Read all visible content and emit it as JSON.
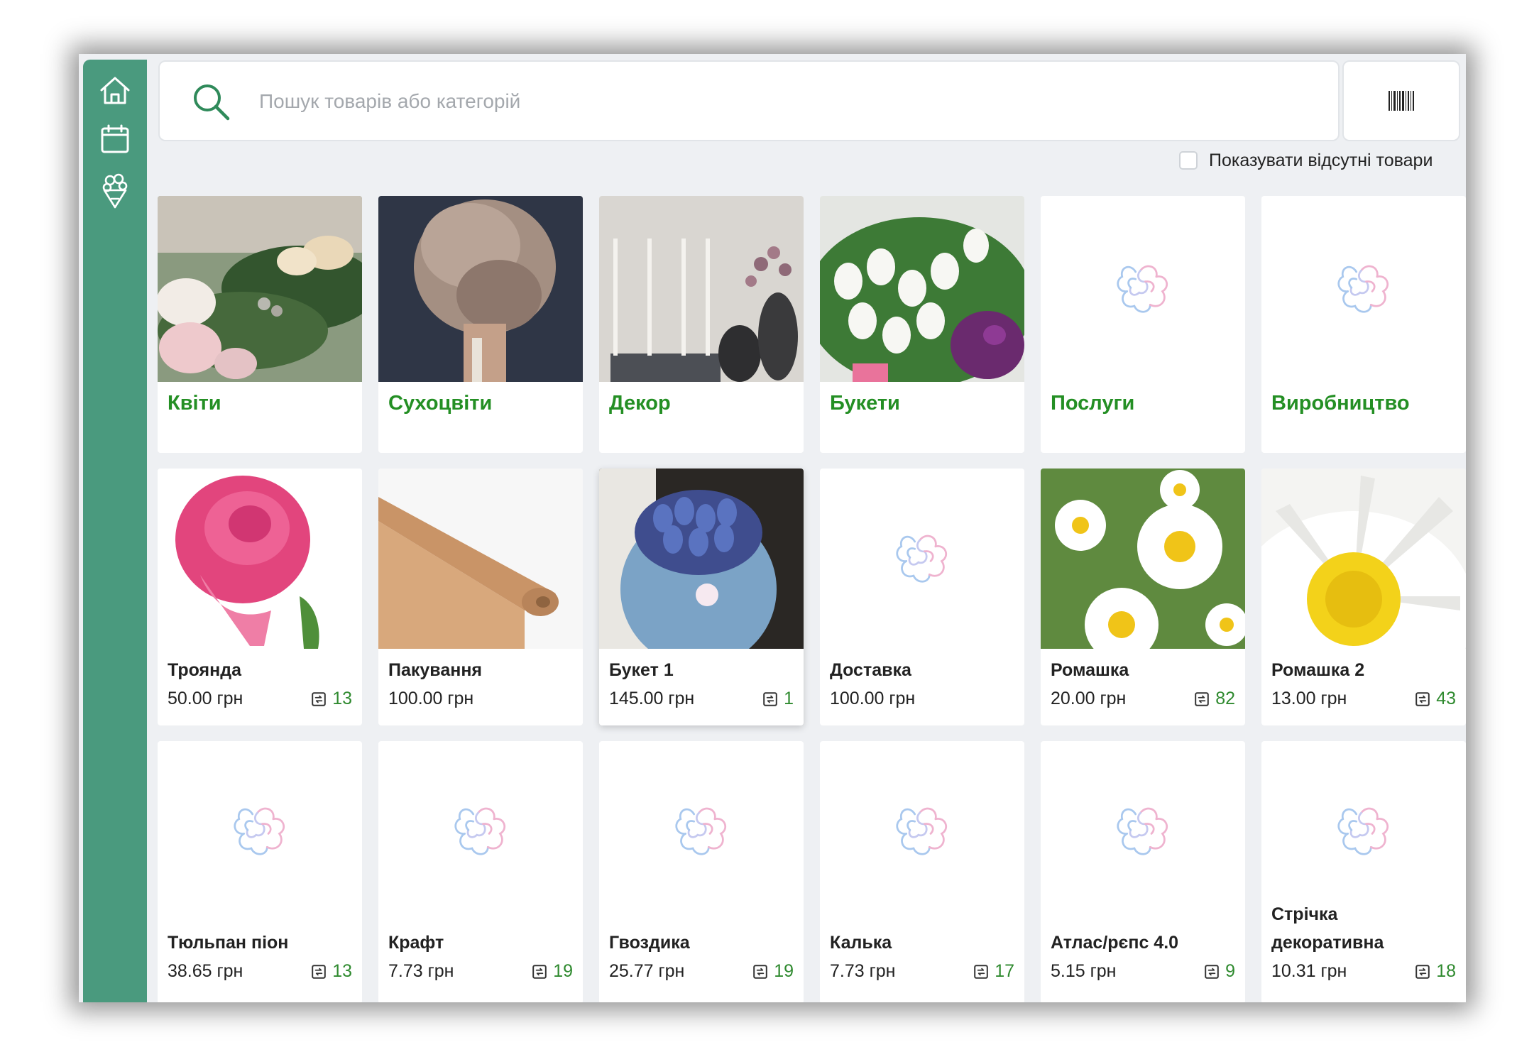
{
  "search": {
    "placeholder": "Пошук товарів або категорій"
  },
  "show_missing_label": "Показувати відсутні товари",
  "colors": {
    "sidebar": "#4a9a7e",
    "accent_green": "#248f24",
    "stock_green": "#2f8a2f"
  },
  "sidebar": {
    "items": [
      {
        "icon": "home-icon"
      },
      {
        "icon": "calendar-icon"
      },
      {
        "icon": "bouquet-icon"
      }
    ]
  },
  "categories": [
    {
      "title": "Квіти",
      "image": "flowers-photo"
    },
    {
      "title": "Сухоцвіти",
      "image": "dried-flowers-photo"
    },
    {
      "title": "Декор",
      "image": "decor-candles-photo"
    },
    {
      "title": "Букети",
      "image": "bouquets-tulips-photo"
    },
    {
      "title": "Послуги",
      "image": "logo-placeholder"
    },
    {
      "title": "Виробництво",
      "image": "logo-placeholder"
    }
  ],
  "products": [
    {
      "name": "Троянда",
      "price": "50.00 грн",
      "stock": "13",
      "image": "rose-photo"
    },
    {
      "name": "Пакування",
      "price": "100.00 грн",
      "stock": "",
      "image": "kraft-paper-roll-photo"
    },
    {
      "name": "Букет 1",
      "price": "145.00 грн",
      "stock": "1",
      "image": "blue-tulip-bouquet-photo"
    },
    {
      "name": "Доставка",
      "price": "100.00 грн",
      "stock": "",
      "image": "logo-placeholder"
    },
    {
      "name": "Ромашка",
      "price": "20.00 грн",
      "stock": "82",
      "image": "daisies-photo"
    },
    {
      "name": "Ромашка 2",
      "price": "13.00 грн",
      "stock": "43",
      "image": "daisy-closeup-photo"
    },
    {
      "name": "Тюльпан піон",
      "price": "38.65 грн",
      "stock": "13",
      "image": "logo-placeholder"
    },
    {
      "name": "Крафт",
      "price": "7.73 грн",
      "stock": "19",
      "image": "logo-placeholder"
    },
    {
      "name": "Гвоздика",
      "price": "25.77 грн",
      "stock": "19",
      "image": "logo-placeholder"
    },
    {
      "name": "Калька",
      "price": "7.73 грн",
      "stock": "17",
      "image": "logo-placeholder"
    },
    {
      "name": "Атлас/рєпс 4.0",
      "price": "5.15 грн",
      "stock": "9",
      "image": "logo-placeholder"
    },
    {
      "name_line1": "Стрічка",
      "name_line2": "декоративна",
      "price": "10.31 грн",
      "stock": "18",
      "image": "logo-placeholder"
    }
  ]
}
